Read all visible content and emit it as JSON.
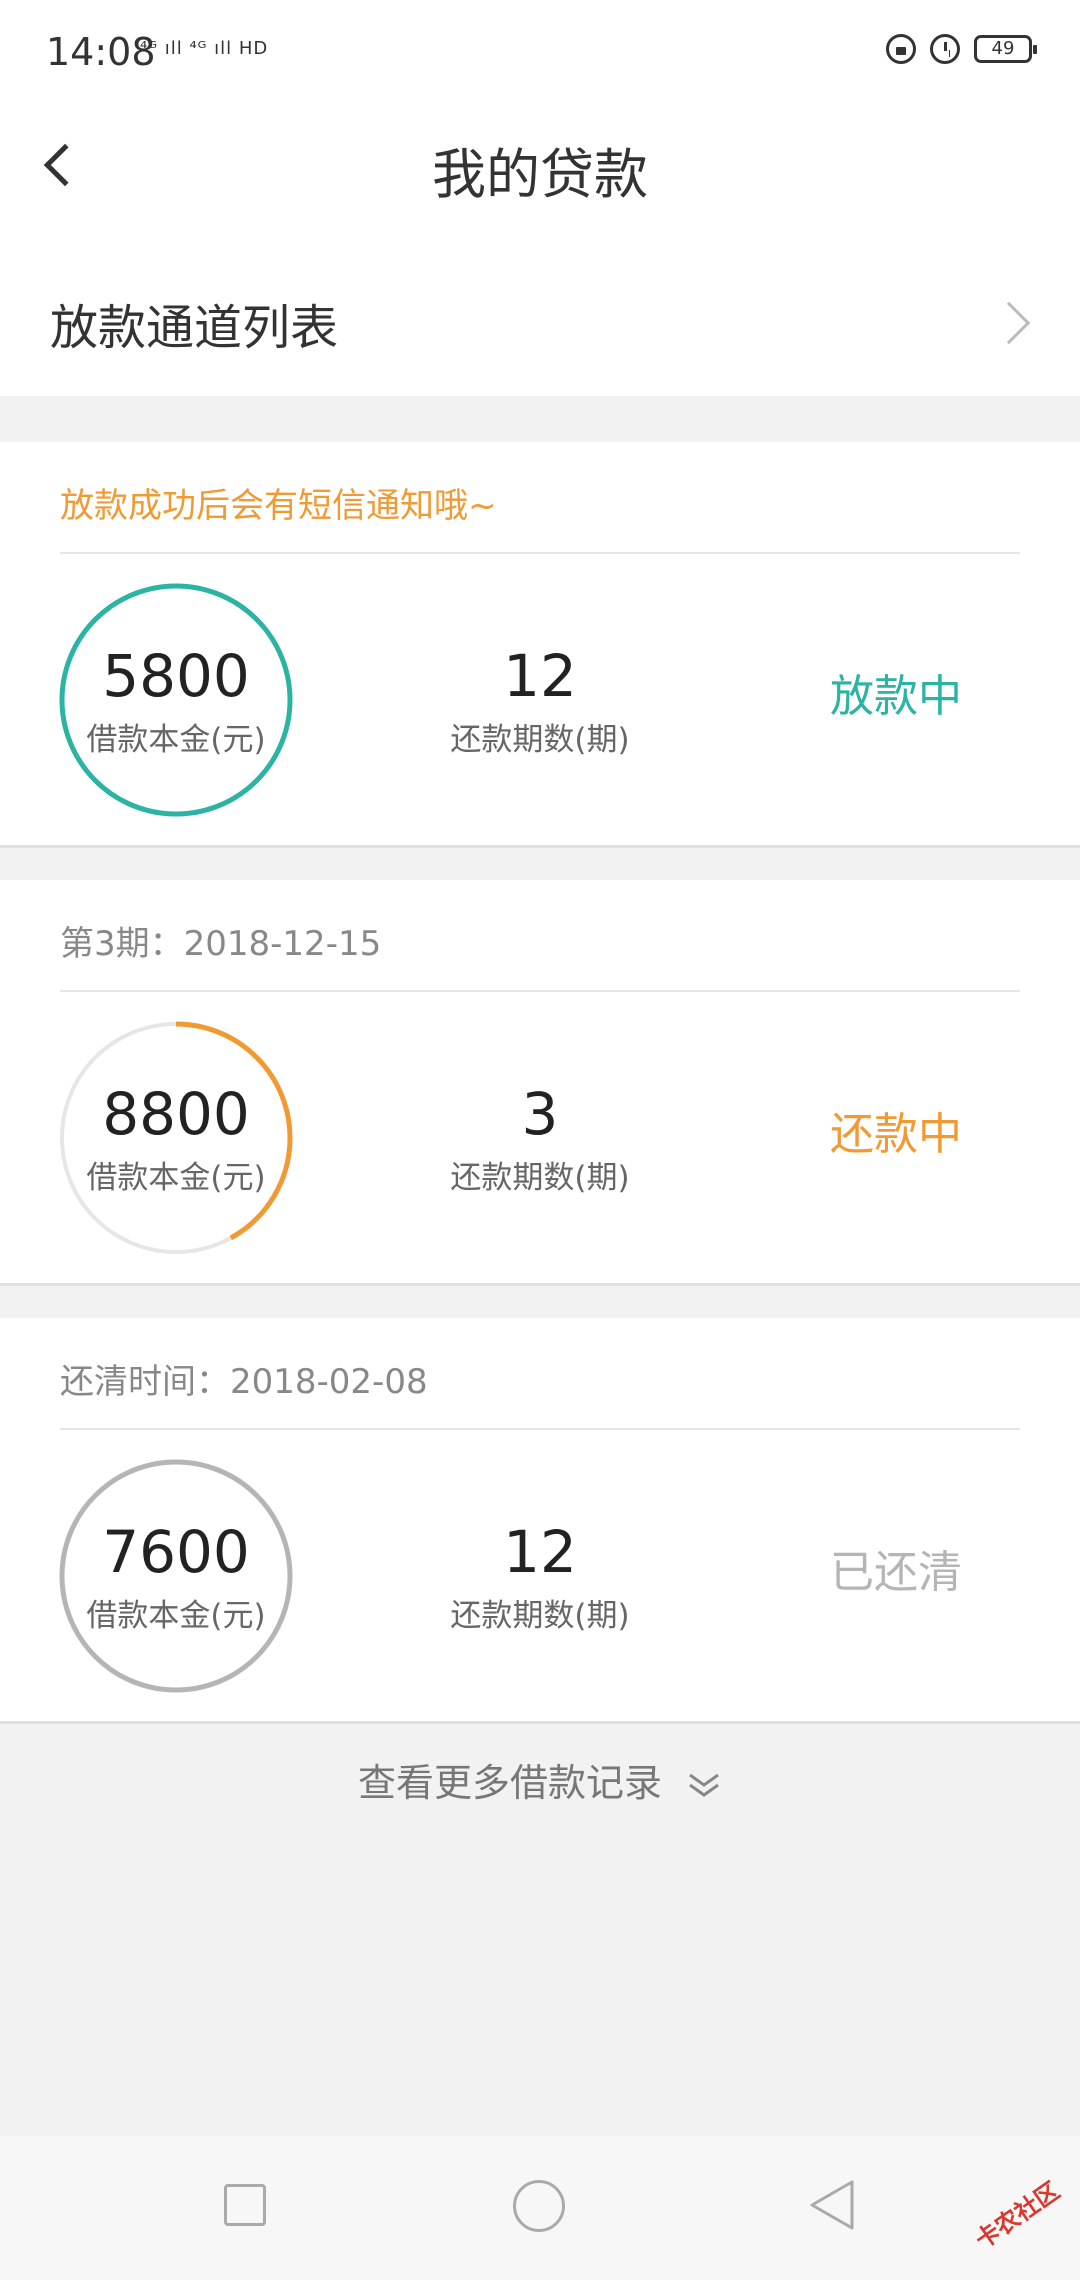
{
  "statusbar": {
    "time": "14:08",
    "signal": "⁴ᴳ ıll ⁴ᴳ ıll HD",
    "battery": "49"
  },
  "header": {
    "title": "我的贷款"
  },
  "channel": {
    "label": "放款通道列表"
  },
  "colors": {
    "teal": "#2bb3a3",
    "orange": "#f19a34",
    "gray": "#b5b5b5"
  },
  "loans": [
    {
      "note": "放款成功后会有短信通知哦~",
      "amount": "5800",
      "amount_label": "借款本金(元)",
      "periods": "12",
      "periods_label": "还款期数(期)",
      "status": "放款中",
      "ring_color": "#2bb3a3",
      "ring_fraction": 1.0
    },
    {
      "note": "第3期：2018-12-15",
      "amount": "8800",
      "amount_label": "借款本金(元)",
      "periods": "3",
      "periods_label": "还款期数(期)",
      "status": "还款中",
      "ring_color": "#f19a34",
      "ring_fraction": 0.42
    },
    {
      "note": "还清时间：2018-02-08",
      "amount": "7600",
      "amount_label": "借款本金(元)",
      "periods": "12",
      "periods_label": "还款期数(期)",
      "status": "已还清",
      "ring_color": "#b5b5b5",
      "ring_fraction": 1.0
    }
  ],
  "more": {
    "label": "查看更多借款记录"
  },
  "watermark": {
    "text": "卡农社区"
  }
}
